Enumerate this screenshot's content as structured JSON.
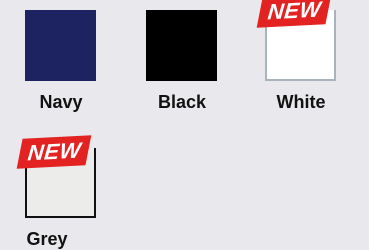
{
  "swatches": [
    {
      "label": "Navy",
      "color": "#1d2260",
      "new": false
    },
    {
      "label": "Black",
      "color": "#000000",
      "new": false
    },
    {
      "label": "White",
      "color": "#ffffff",
      "border": "#a8b4bd",
      "new": true
    },
    {
      "label": "Grey",
      "color": "#ececea",
      "border": "#111111",
      "new": true
    }
  ],
  "badge": {
    "text": "NEW",
    "color": "#e32222"
  }
}
